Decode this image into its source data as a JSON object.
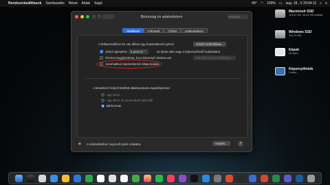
{
  "menubar": {
    "app_name": "Rendszerbeállítások",
    "items": [
      "Szerkesztés",
      "Nézet",
      "Ablak",
      "Súgó"
    ],
    "temperature": "49°",
    "battery": "100%",
    "clock": "aug. 18., V 20:04:11"
  },
  "window": {
    "title": "Biztonság és adatvédelem",
    "search_placeholder": "Keresés",
    "tabs": [
      "Általános",
      "FileVault",
      "Tűzfal",
      "Adatvédelem"
    ],
    "active_tab": "Általános",
    "password_section": {
      "text": "A felhasználóhoz be van állítva egy bejelentkezési jelszó",
      "change_button": "Jelszó módosítása...",
      "require_password_label": "Jelszó igénylése",
      "require_password_delay": "5 perccel",
      "require_password_suffix": "az alvás után vagy a képernyővédő indulásakor",
      "show_message_label": "Üzenet megjelenítése, ha a képernyő zárolva van",
      "set_message_button": "Zárolási üzenet beállítása...",
      "auto_login_label": "Automatikus bejelentkezés kikapcsolása"
    },
    "download_section": {
      "title": "A következő helyről letöltött alkalmazások engedélyezése:",
      "options": [
        "App Store",
        "App Store és azonosított fejlesztők",
        "Bárhonnan"
      ],
      "selected": "Bárhonnan"
    },
    "footer": {
      "lock_text": "A módosításhoz meg kell nyitni a lakatra.",
      "advanced_button": "Haladó...",
      "help": "?"
    }
  },
  "desktop_icons": [
    {
      "name": "Macintosh SSD",
      "sub": "119,51 GB, 45,44 GB szabad"
    },
    {
      "name": "Windows SSD",
      "sub": "119,73 GB"
    },
    {
      "name": "Képek",
      "sub": "40 elem"
    },
    {
      "name": "Képernyőfotók",
      "sub": "2 elem"
    }
  ],
  "colors": {
    "accent": "#2f6fd6",
    "highlight": "#e02020"
  }
}
